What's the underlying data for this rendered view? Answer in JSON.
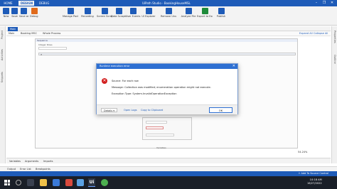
{
  "app": {
    "title": "UiPath Studio - BookingHouseMSL",
    "tabs": [
      "HOME",
      "DESIGN",
      "DEBUG"
    ],
    "window_controls": [
      "–",
      "❐",
      "✕"
    ]
  },
  "ribbon": {
    "buttons": [
      {
        "label": "New",
        "icon": "new-icon",
        "color": "#1e5bb8"
      },
      {
        "label": "Save",
        "icon": "save-icon",
        "color": "#1e5bb8"
      },
      {
        "label": "Save as Template",
        "icon": "template-icon",
        "color": "#1e5bb8"
      },
      {
        "label": "Debug File",
        "icon": "debug-icon",
        "color": "#e06a1b"
      },
      {
        "label": "Manage Packages",
        "icon": "packages-icon",
        "color": "#1e5bb8"
      },
      {
        "label": "Recording",
        "icon": "recording-icon",
        "color": "#1e5bb8"
      },
      {
        "label": "Screen Scraping",
        "icon": "scraping-icon",
        "color": "#1e5bb8"
      },
      {
        "label": "Data Scraping",
        "icon": "data-scraping-icon",
        "color": "#1e5bb8"
      },
      {
        "label": "User Events",
        "icon": "events-icon",
        "color": "#1e5bb8"
      },
      {
        "label": "UI Explorer",
        "icon": "explorer-icon",
        "color": "#1e5bb8"
      },
      {
        "label": "Remove Unused Variables",
        "icon": "remove-vars-icon",
        "color": "#1e5bb8"
      },
      {
        "label": "Analyze File",
        "icon": "analyze-icon",
        "color": "#1e5bb8"
      },
      {
        "label": "Export to Excel",
        "icon": "excel-icon",
        "color": "#1e8b3a"
      },
      {
        "label": "Publish",
        "icon": "publish-icon",
        "color": "#1e5bb8"
      }
    ]
  },
  "left_strip": [
    "Project",
    "Activities",
    "Snippets"
  ],
  "right_strip": [
    "Properties",
    "Outline"
  ],
  "doc_tab": {
    "label": "Main"
  },
  "breadcrumbs": {
    "items": [
      "Main",
      "Booking MSC",
      "Whole Process"
    ],
    "expand_all": "Expand All",
    "collapse_all": "Collapse All"
  },
  "designer": {
    "sequence_header": "Sequence",
    "inner_label": "Integer Rows",
    "if_label": "If",
    "variables_text": "Variables"
  },
  "dialog": {
    "title": "Runtime execution error",
    "source": "Source: For each row",
    "message": "Message: Collection was modified; enumeration operation might not execute.",
    "exception": "Exception Type: System.InvalidOperationException",
    "details_label": "Details",
    "open_logs": "Open Logs",
    "copy_clipboard": "Copy to Clipboard",
    "ok_label": "OK"
  },
  "bottom_tabs": [
    "Variables",
    "Arguments",
    "Imports"
  ],
  "zoom": {
    "level": "54.24%"
  },
  "output_tabs": [
    "Output",
    "Error List",
    "Breakpoints"
  ],
  "status": {
    "add_source_control": "+ Add To Source Control"
  },
  "taskbar": {
    "time": "10:18 AM",
    "date": "16/27/2022",
    "ui_label": "Ui"
  }
}
